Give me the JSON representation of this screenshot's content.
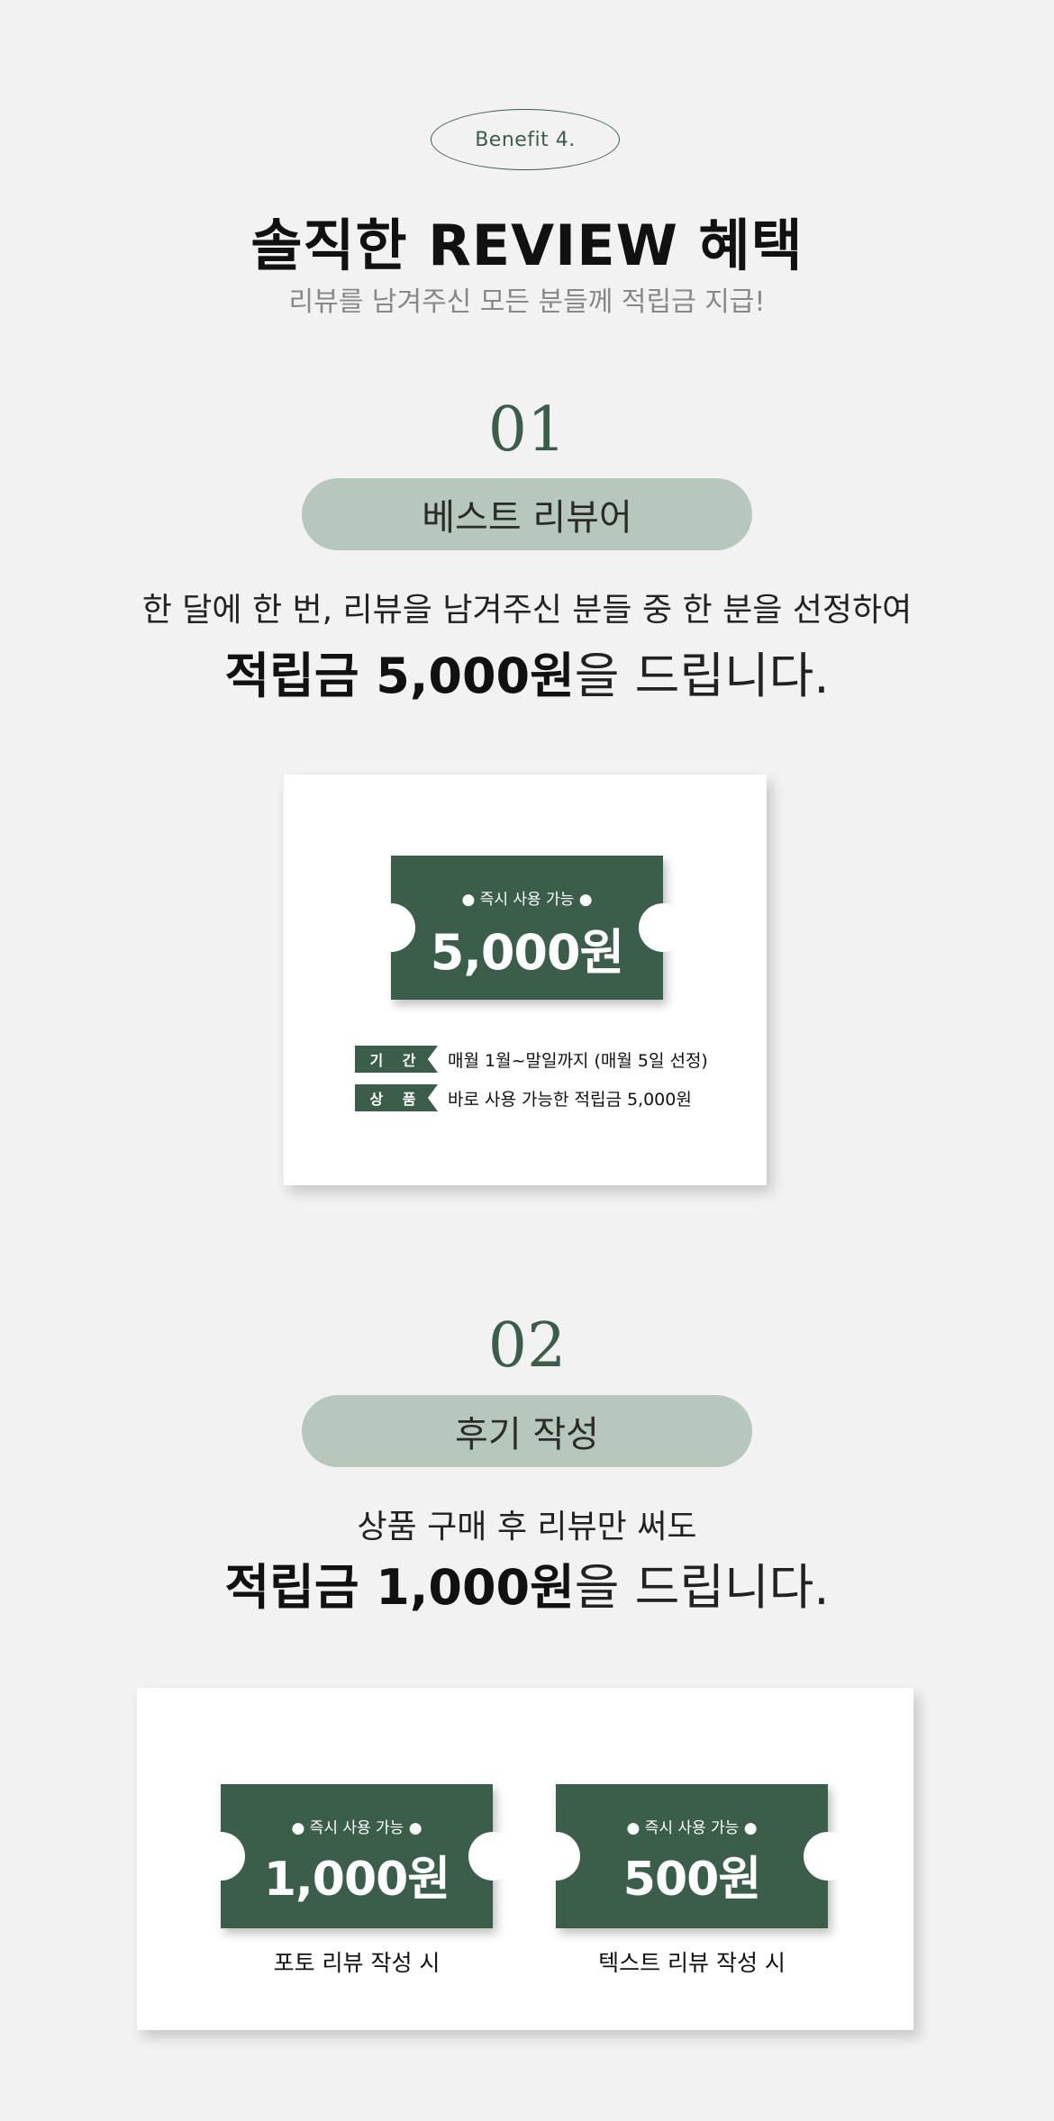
{
  "header": {
    "badge": "Benefit 4.",
    "title": "솔직한 REVIEW 혜택",
    "subtitle": "리뷰를 남겨주신 모든 분들께 적립금 지급!"
  },
  "section1": {
    "number": "01",
    "pill": "베스트 리뷰어",
    "line1": "한 달에 한 번, 리뷰을 남겨주신 분들 중 한 분을 선정하여",
    "line2_bold": "적립금 5,000원",
    "line2_rest": "을 드립니다.",
    "ticket": {
      "top": "● 즉시 사용 가능 ●",
      "amount": "5,000원"
    },
    "details": [
      {
        "tag": "기 간",
        "text": "매월 1월~말일까지 (매월 5일 선정)"
      },
      {
        "tag": "상 품",
        "text": "바로 사용 가능한 적립금 5,000원"
      }
    ]
  },
  "section2": {
    "number": "02",
    "pill": "후기 작성",
    "line1": "상품 구매 후 리뷰만 써도",
    "line2_bold": "적립금 1,000원",
    "line2_rest": "을 드립니다.",
    "tickets": [
      {
        "top": "● 즉시 사용 가능 ●",
        "amount": "1,000원",
        "caption": "포토 리뷰 작성 시"
      },
      {
        "top": "● 즉시 사용 가능 ●",
        "amount": "500원",
        "caption": "텍스트 리뷰 작성 시"
      }
    ]
  },
  "colors": {
    "accent_green": "#3a5e4a",
    "pill_green": "#b6c7bb",
    "background": "#f2f2f2"
  }
}
